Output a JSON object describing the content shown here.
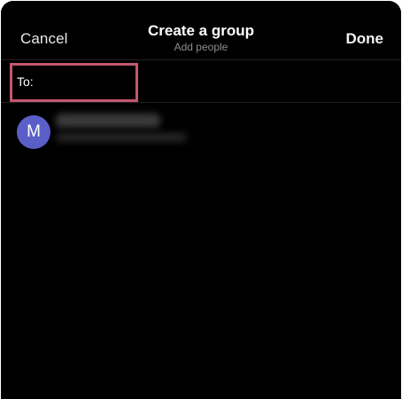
{
  "header": {
    "cancel_label": "Cancel",
    "title": "Create a group",
    "subtitle": "Add people",
    "done_label": "Done"
  },
  "recipient_field": {
    "label": "To:",
    "value": ""
  },
  "contacts": [
    {
      "avatar_initial": "M",
      "avatar_color": "#5a5fc8"
    }
  ],
  "colors": {
    "background": "#000000",
    "highlight_border": "#c2586e",
    "avatar": "#5a5fc8",
    "subtitle": "#8e8e93"
  }
}
